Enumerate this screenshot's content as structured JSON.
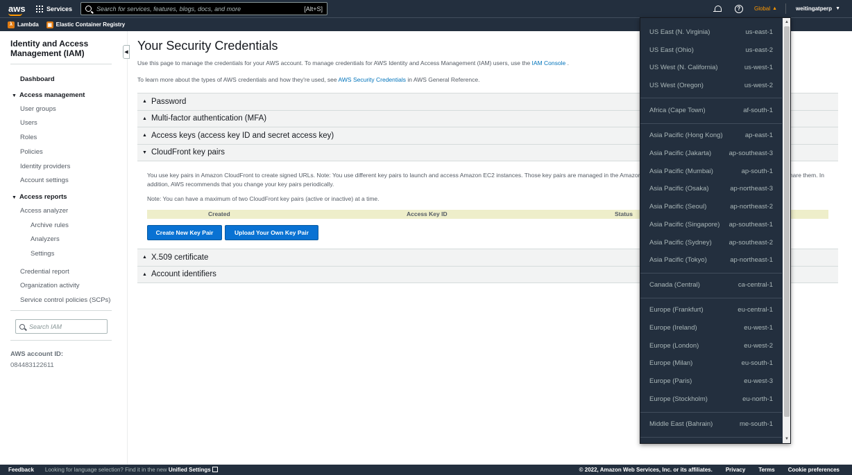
{
  "nav": {
    "logo": "aws",
    "services_label": "Services",
    "search_placeholder": "Search for services, features, blogs, docs, and more",
    "search_shortcut": "[Alt+S]",
    "region_label": "Global",
    "account_label": "weitingatperp"
  },
  "favorites": [
    {
      "label": "Lambda"
    },
    {
      "label": "Elastic Container Registry"
    }
  ],
  "sidebar": {
    "title": "Identity and Access Management (IAM)",
    "dashboard": "Dashboard",
    "access_management": "Access management",
    "user_groups": "User groups",
    "users": "Users",
    "roles": "Roles",
    "policies": "Policies",
    "identity_providers": "Identity providers",
    "account_settings": "Account settings",
    "access_reports": "Access reports",
    "access_analyzer": "Access analyzer",
    "archive_rules": "Archive rules",
    "analyzers": "Analyzers",
    "settings": "Settings",
    "credential_report": "Credential report",
    "organization_activity": "Organization activity",
    "scps": "Service control policies (SCPs)",
    "search_placeholder": "Search IAM",
    "account_id_label": "AWS account ID:",
    "account_id": "084483122611"
  },
  "main": {
    "title": "Your Security Credentials",
    "intro1_pre": "Use this page to manage the credentials for your AWS account. To manage credentials for AWS Identity and Access Management (IAM) users, use the ",
    "intro1_link": "IAM Console",
    "intro1_post": " .",
    "intro2_pre": "To learn more about the types of AWS credentials and how they're used, see ",
    "intro2_link": "AWS Security Credentials",
    "intro2_post": " in AWS General Reference.",
    "sections": {
      "password": "Password",
      "mfa": "Multi-factor authentication (MFA)",
      "access_keys": "Access keys (access key ID and secret access key)",
      "cloudfront": "CloudFront key pairs",
      "x509": "X.509 certificate",
      "account_identifiers": "Account identifiers"
    },
    "cloudfront": {
      "para1": "You use key pairs in Amazon CloudFront to create signed URLs. Note: You use different key pairs to launch and access Amazon EC2 instances. Those key pairs are managed in the Amazon EC2 console. Keep your key pairs securely and do not share them. In addition, AWS recommends that you change your key pairs periodically.",
      "para2": "Note: You can have a maximum of two CloudFront key pairs (active or inactive) at a time.",
      "columns": {
        "created": "Created",
        "access_key_id": "Access Key ID",
        "status": "Status"
      },
      "create_button": "Create New Key Pair",
      "upload_button": "Upload Your Own Key Pair"
    }
  },
  "regions": [
    {
      "name": "US East (N. Virginia)",
      "code": "us-east-1"
    },
    {
      "name": "US East (Ohio)",
      "code": "us-east-2"
    },
    {
      "name": "US West (N. California)",
      "code": "us-west-1"
    },
    {
      "name": "US West (Oregon)",
      "code": "us-west-2"
    },
    {
      "name": "Africa (Cape Town)",
      "code": "af-south-1"
    },
    {
      "name": "Asia Pacific (Hong Kong)",
      "code": "ap-east-1"
    },
    {
      "name": "Asia Pacific (Jakarta)",
      "code": "ap-southeast-3"
    },
    {
      "name": "Asia Pacific (Mumbai)",
      "code": "ap-south-1"
    },
    {
      "name": "Asia Pacific (Osaka)",
      "code": "ap-northeast-3"
    },
    {
      "name": "Asia Pacific (Seoul)",
      "code": "ap-northeast-2"
    },
    {
      "name": "Asia Pacific (Singapore)",
      "code": "ap-southeast-1"
    },
    {
      "name": "Asia Pacific (Sydney)",
      "code": "ap-southeast-2"
    },
    {
      "name": "Asia Pacific (Tokyo)",
      "code": "ap-northeast-1"
    },
    {
      "name": "Canada (Central)",
      "code": "ca-central-1"
    },
    {
      "name": "Europe (Frankfurt)",
      "code": "eu-central-1"
    },
    {
      "name": "Europe (Ireland)",
      "code": "eu-west-1"
    },
    {
      "name": "Europe (London)",
      "code": "eu-west-2"
    },
    {
      "name": "Europe (Milan)",
      "code": "eu-south-1"
    },
    {
      "name": "Europe (Paris)",
      "code": "eu-west-3"
    },
    {
      "name": "Europe (Stockholm)",
      "code": "eu-north-1"
    },
    {
      "name": "Middle East (Bahrain)",
      "code": "me-south-1"
    }
  ],
  "footer": {
    "feedback": "Feedback",
    "lang_text": "Looking for language selection? Find it in the new ",
    "lang_link": "Unified Settings",
    "copyright": "© 2022, Amazon Web Services, Inc. or its affiliates.",
    "privacy": "Privacy",
    "terms": "Terms",
    "cookies": "Cookie preferences"
  },
  "icons": {
    "services": "grid-icon",
    "search": "search-icon",
    "notifications": "bell-icon",
    "help": "help-icon",
    "collapse": "chevron-left-icon"
  },
  "colors": {
    "nav_bg": "#232f3e",
    "accent": "#ff9900",
    "link": "#0073bb",
    "primary_button": "#0972d3"
  }
}
